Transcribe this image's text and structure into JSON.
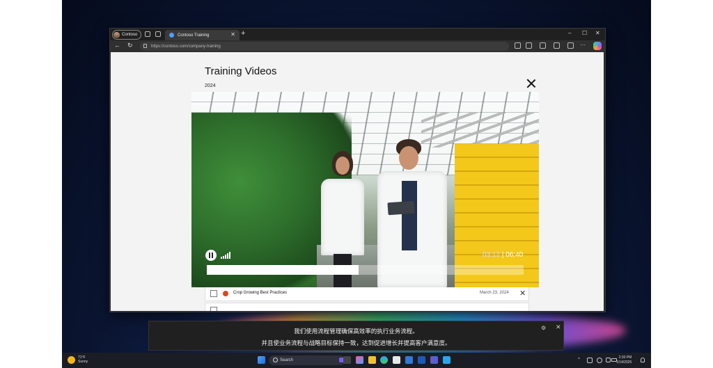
{
  "browser": {
    "profile_label": "Contoso",
    "tab_title": "Contoso Training",
    "tab_close": "✕",
    "new_tab": "+",
    "url": "https://contoso.com/company-training",
    "window_controls": [
      "–",
      "☐",
      "✕"
    ],
    "nav": {
      "back": "←",
      "refresh": "↻"
    },
    "toolbar_icons": [
      "read-aloud-icon",
      "favorite-star-icon",
      "split-screen-icon",
      "favorites-icon",
      "collections-icon",
      "more-icon",
      "copilot-icon"
    ],
    "more_label": "···"
  },
  "page": {
    "title": "Training Videos",
    "year": "2024",
    "video": {
      "current_time": "03:12",
      "separator": " | ",
      "duration": "06:40",
      "progress_fraction": 0.48,
      "state": "playing"
    },
    "list": [
      {
        "title": "Crop Growing Best Practices",
        "date": "March 23, 2024",
        "remove": "✕"
      }
    ]
  },
  "captions": {
    "line1": "我们使用流程管理确保高效率的执行业务流程。",
    "line2": "并且使业务流程与战略目标保持一致，达到促进增长并提高客户满意度。",
    "close": "✕",
    "settings": "⚙"
  },
  "taskbar": {
    "weather_temp": "71°F",
    "weather_desc": "Sunny",
    "search_label": "Search",
    "time": "2:30 PM",
    "date": "1/14/2025",
    "tray_chevron": "^"
  },
  "colors": {
    "accent": "#4ea0ff",
    "page_bg": "#f3f3f3",
    "crate_yellow": "#f3c81a"
  }
}
